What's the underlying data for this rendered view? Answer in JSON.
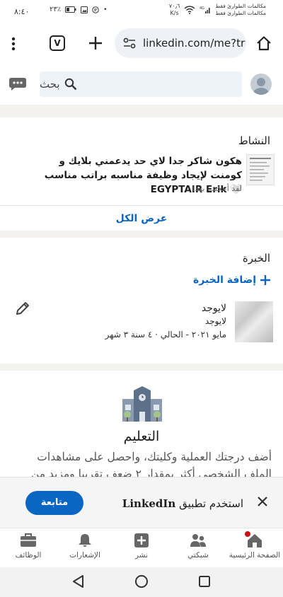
{
  "status_bar": {
    "time": "٨:٤٠",
    "battery": "٢٣٪",
    "speed_value": "٧٠٫٦",
    "speed_unit": "K/s",
    "carrier_1": "مكالمات الطوارئ فقط",
    "carrier_2": "مكالمات الطوارئ فقط"
  },
  "browser": {
    "url": "linkedin.com/me?tr",
    "tab_count": "V"
  },
  "linkedin_header": {
    "search_placeholder": "بحث"
  },
  "activity": {
    "heading": "النشاط",
    "post_text": "هكون شاكر جدا لاي حد يدعمني بلايك و كومنت لإيجاد وظيفة مناسبه براتب مناسب 🤍 EGYPTAIR Erik",
    "post_meta": "لقد أعجبت بهذا",
    "show_all": "عرض الكل"
  },
  "experience": {
    "heading": "الخبرة",
    "add_label": "إضافة الخبرة",
    "title": "لايوجد",
    "company": "لايوجد",
    "dates": "مايو ٢٠٢١ - الحالي · ٤ سنة ٣ شهر"
  },
  "education": {
    "heading": "التعليم",
    "description": "أضف درجتك العملية وكليتك، واحصل على مشاهدات الملف الشخصي أكثر بمقدار ٢ ضعف تقريبا ومزيد من الفرص"
  },
  "app_banner": {
    "text_prefix": "استخدم تطبيق",
    "brand": "LinkedIn",
    "continue_label": "متابعة"
  },
  "bottom_nav": {
    "home": "الصفحة الرئيسية",
    "network": "شبكتي",
    "post": "نشر",
    "notifications": "الإشعارات",
    "jobs": "الوظائف"
  },
  "colors": {
    "accent": "#0a66c2",
    "badge": "#cc1016"
  }
}
